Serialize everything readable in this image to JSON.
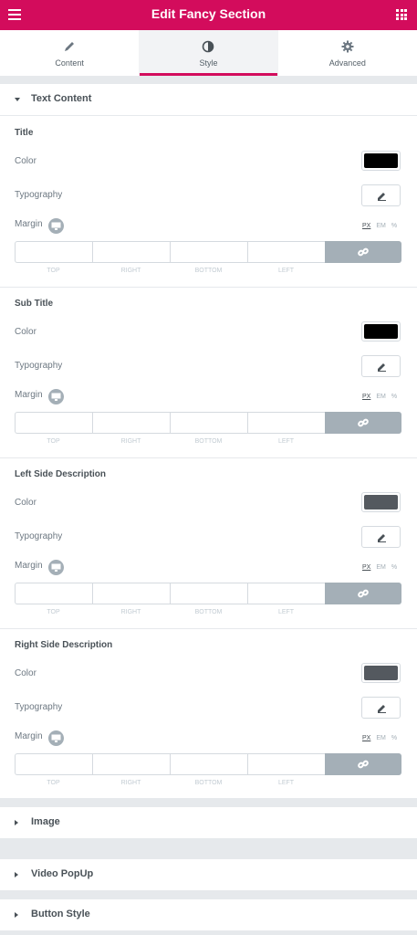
{
  "header": {
    "title": "Edit Fancy Section",
    "menu_icon": "hamburger-icon",
    "grid_icon": "apps-grid-icon",
    "color": "#d30c5c"
  },
  "tabs": [
    {
      "label": "Content",
      "icon": "pencil-icon",
      "active": false
    },
    {
      "label": "Style",
      "icon": "contrast-icon",
      "active": true
    },
    {
      "label": "Advanced",
      "icon": "gear-icon",
      "active": false
    }
  ],
  "sections": {
    "text_content": "Text Content",
    "image": "Image",
    "video_popup": "Video PopUp",
    "button_style": "Button Style"
  },
  "common": {
    "color_label": "Color",
    "typography_label": "Typography",
    "margin_label": "Margin",
    "units": [
      "PX",
      "EM",
      "%"
    ],
    "dims": [
      "TOP",
      "RIGHT",
      "BOTTOM",
      "LEFT"
    ]
  },
  "groups": [
    {
      "title": "Title",
      "color": "#000000"
    },
    {
      "title": "Sub Title",
      "color": "#000000"
    },
    {
      "title": "Left Side Description",
      "color": "#54595f"
    },
    {
      "title": "Right Side Description",
      "color": "#54595f"
    }
  ]
}
